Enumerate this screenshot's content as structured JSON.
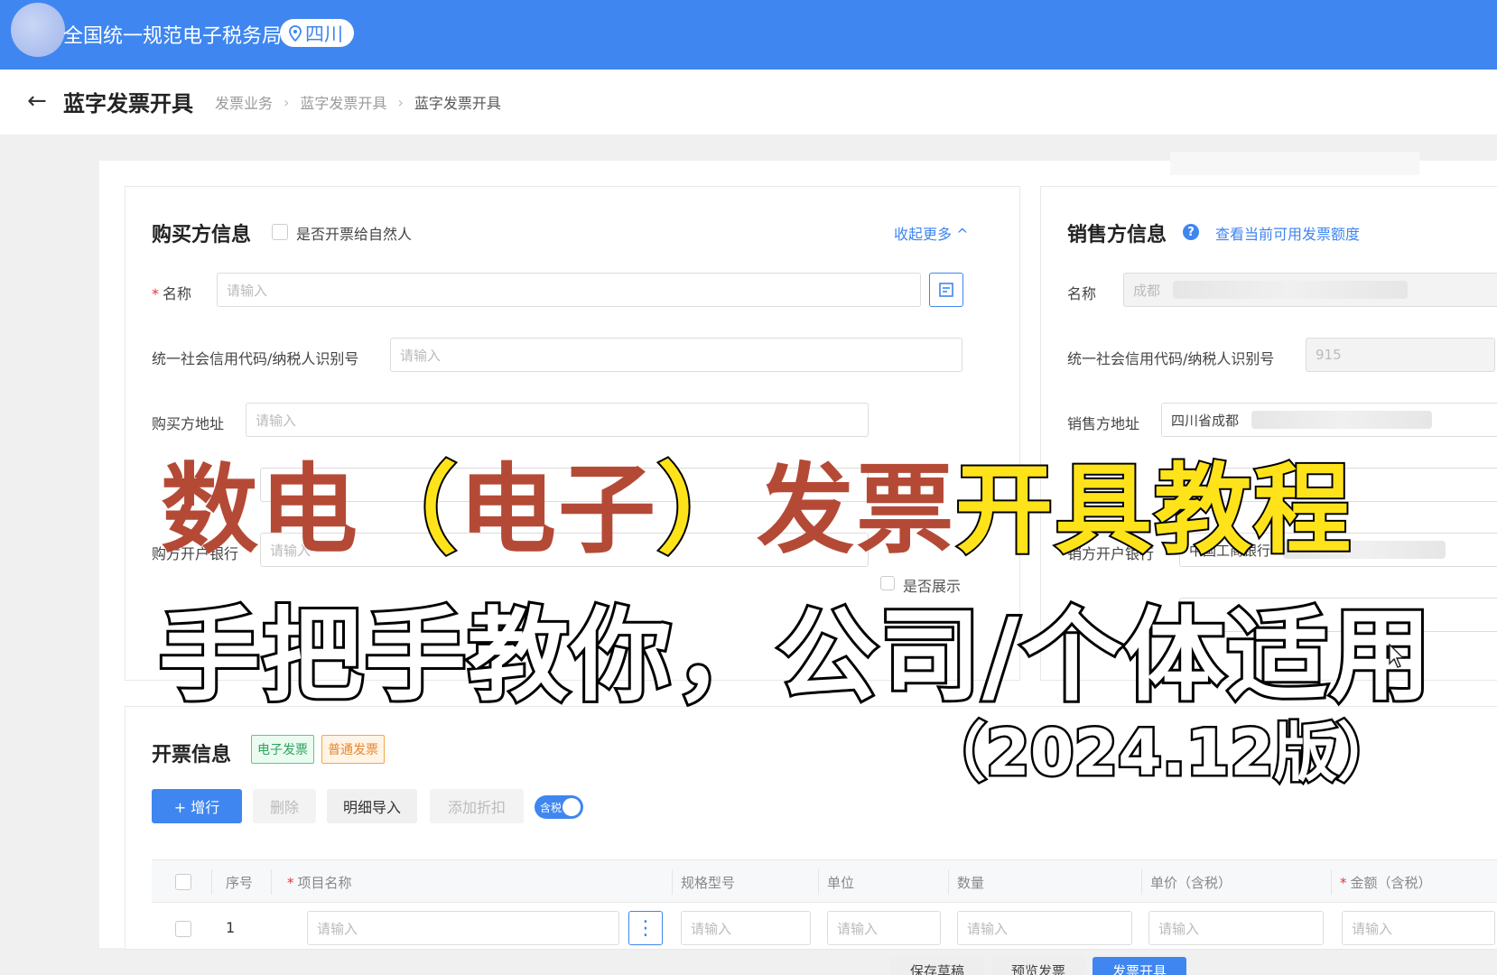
{
  "topbar": {
    "app_title": "全国统一规范电子税务局",
    "region": "四川"
  },
  "header": {
    "back_icon": "arrow-left-icon",
    "title": "蓝字发票开具",
    "breadcrumb": [
      "发票业务",
      "蓝字发票开具",
      "蓝字发票开具"
    ]
  },
  "buyer": {
    "title": "购买方信息",
    "natural_person_label": "是否开票给自然人",
    "collapse_link": "收起更多 ^",
    "name_label": "名称",
    "name_placeholder": "请输入",
    "tax_id_label": "统一社会信用代码/纳税人识别号",
    "tax_id_placeholder": "请输入",
    "address_label": "购买方地址",
    "address_placeholder": "请输入",
    "bank_label": "购方开户银行",
    "bank_placeholder": "请输入",
    "show_label": "是否展示"
  },
  "seller": {
    "title": "销售方信息",
    "quota_link": "查看当前可用发票额度",
    "name_label": "名称",
    "name_value": "成都",
    "tax_id_label": "统一社会信用代码/纳税人识别号",
    "tax_id_value": "915",
    "address_label": "销售方地址",
    "address_value": "四川省成都",
    "bank_label": "销方开户银行",
    "bank_value": "中国工商银行"
  },
  "invoice": {
    "title": "开票信息",
    "tag_electronic": "电子发票",
    "tag_normal": "普通发票",
    "add_row": "+ 增行",
    "delete": "删除",
    "import_detail": "明细导入",
    "add_discount": "添加折扣",
    "tax_included_toggle": "含税",
    "columns": [
      "序号",
      "项目名称",
      "规格型号",
      "单位",
      "数量",
      "单价（含税）",
      "金额（含税）"
    ],
    "row": {
      "index": "1",
      "placeholder": "请输入"
    }
  },
  "bottom_buttons": [
    "保存草稿",
    "预览发票",
    "发票开具"
  ],
  "overlay": {
    "line1_red_a": "数电",
    "line1_paren_open": "（",
    "line1_red_b": "电子",
    "line1_paren_close": "）",
    "line1_red_c": "发票",
    "line1_yellow": "开具教程",
    "line2": "手把手教你，公司/个体适用",
    "line3": "（2024.12版）"
  },
  "colors": {
    "primary": "#3f86f0",
    "overlay_red": "#b44a36",
    "overlay_yellow": "#ffe31a"
  }
}
